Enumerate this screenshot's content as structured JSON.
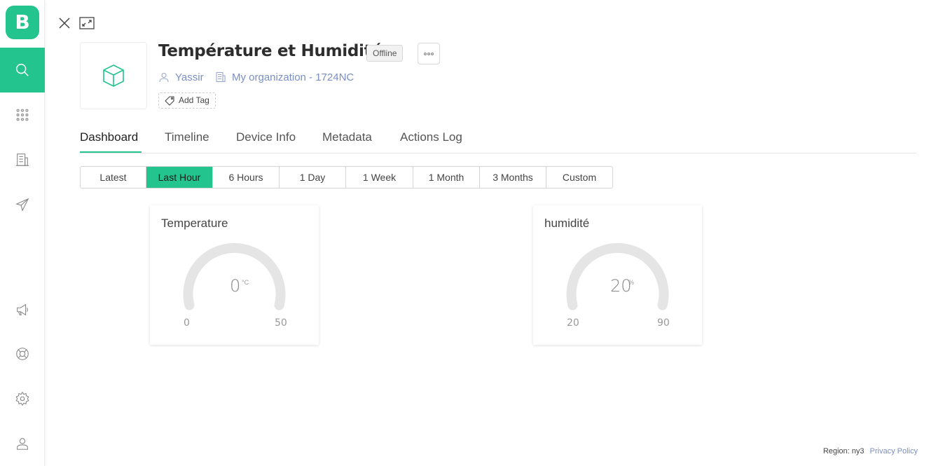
{
  "app": {
    "logo_letter": "B",
    "brand_color": "#23c48e"
  },
  "sidebar": {
    "items": [
      {
        "name": "search",
        "active": true
      },
      {
        "name": "apps"
      },
      {
        "name": "organizations"
      },
      {
        "name": "send"
      },
      {
        "name": "announcements"
      },
      {
        "name": "help"
      },
      {
        "name": "settings"
      },
      {
        "name": "profile"
      }
    ]
  },
  "device": {
    "title": "Température et Humidité",
    "status": "Offline",
    "owner": "Yassir",
    "organization": "My organization - 1724NC",
    "add_tag_label": "Add Tag"
  },
  "tabs": [
    {
      "label": "Dashboard",
      "active": true
    },
    {
      "label": "Timeline"
    },
    {
      "label": "Device Info"
    },
    {
      "label": "Metadata"
    },
    {
      "label": "Actions Log"
    }
  ],
  "time_ranges": [
    {
      "label": "Latest"
    },
    {
      "label": "Last Hour",
      "active": true
    },
    {
      "label": "6 Hours"
    },
    {
      "label": "1 Day"
    },
    {
      "label": "1 Week"
    },
    {
      "label": "1 Month"
    },
    {
      "label": "3 Months"
    },
    {
      "label": "Custom"
    }
  ],
  "widgets": [
    {
      "title": "Temperature",
      "value": "0",
      "unit": "°C",
      "min": "0",
      "max": "50"
    },
    {
      "title": "humidité",
      "value": "20",
      "unit": "%",
      "min": "20",
      "max": "90"
    }
  ],
  "footer": {
    "region": "Region: ny3",
    "privacy": "Privacy Policy"
  }
}
